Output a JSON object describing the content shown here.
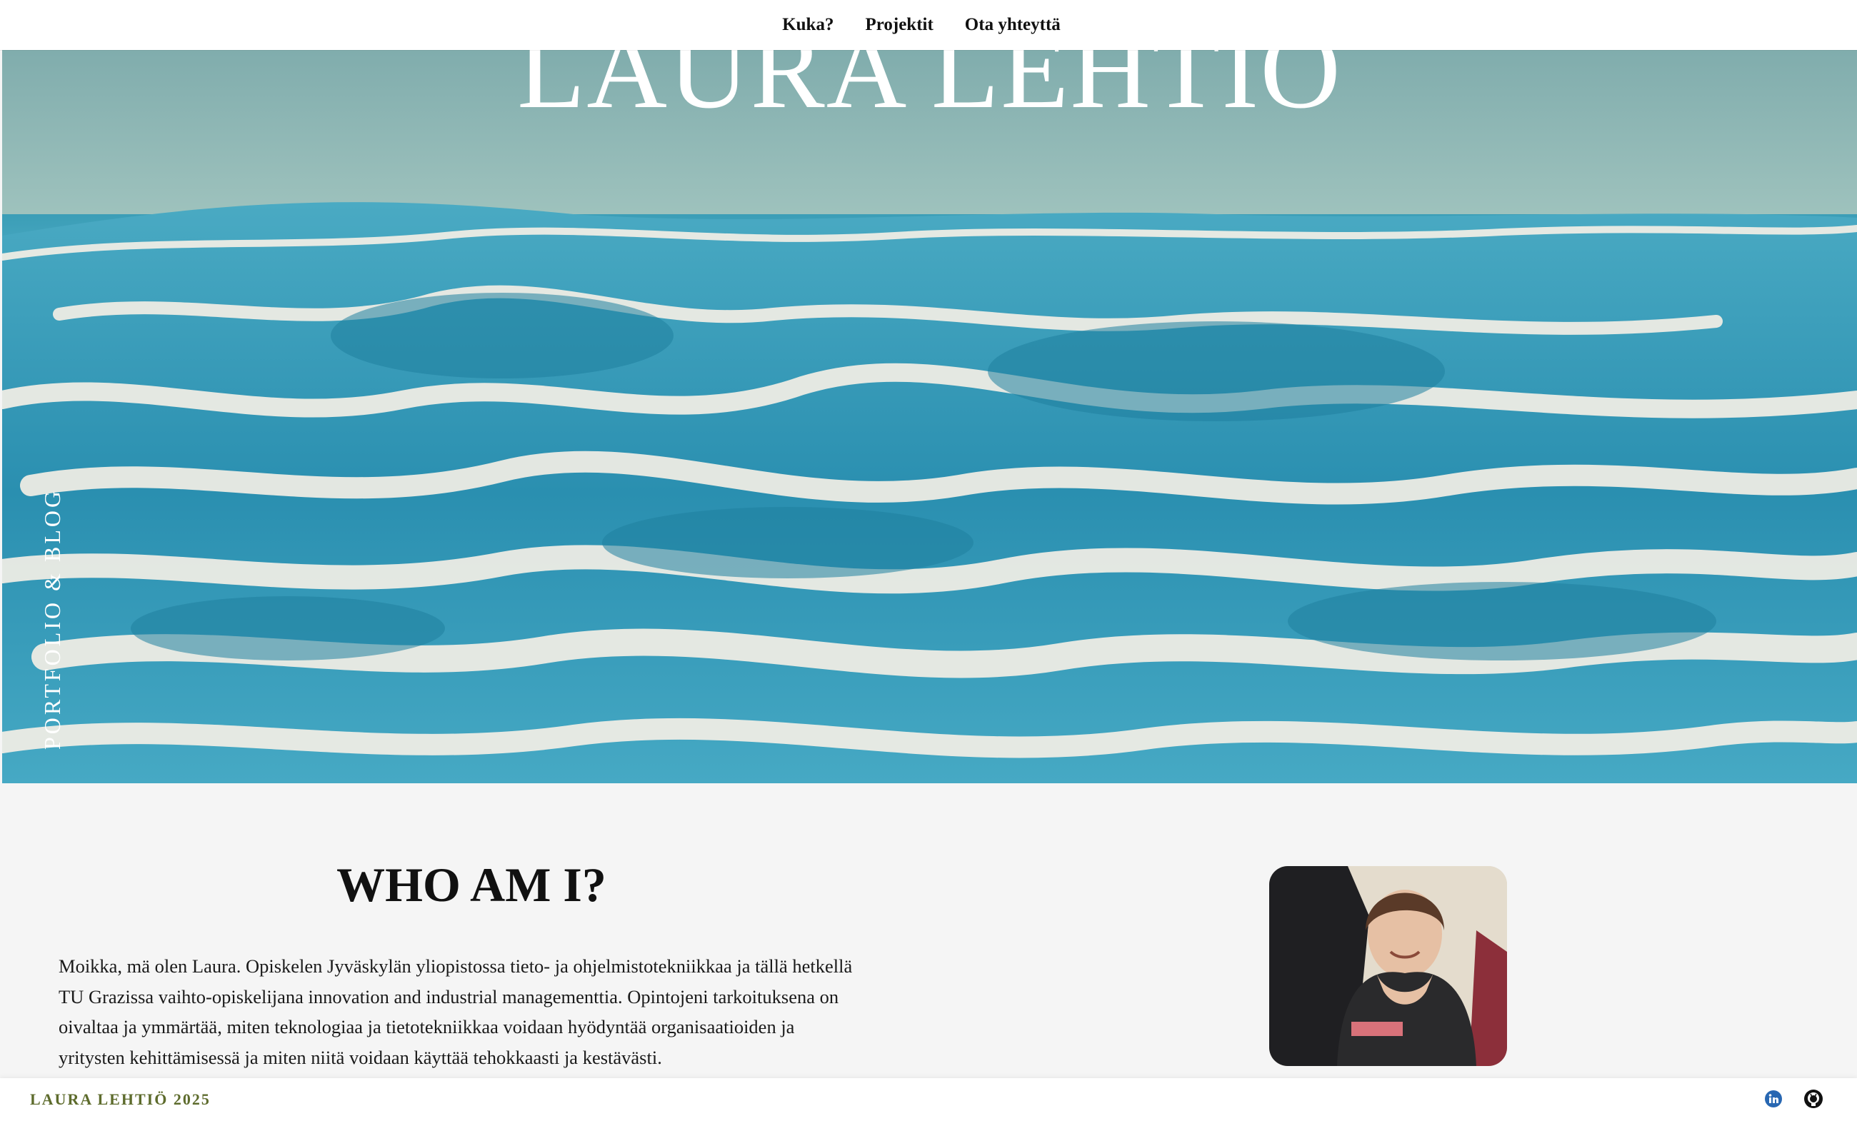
{
  "nav": {
    "items": [
      {
        "label": "Kuka?"
      },
      {
        "label": "Projektit"
      },
      {
        "label": "Ota yhteyttä"
      }
    ]
  },
  "hero": {
    "title": "LAURA LEHTIÖ",
    "side_label": "PORTFOLIO & BLOG"
  },
  "about": {
    "heading": "WHO AM I?",
    "paragraph": "Moikka, mä olen Laura. Opiskelen Jyväskylän yliopistossa tieto- ja ohjelmistotekniikkaa ja tällä hetkellä TU Grazissa vaihto-opiskelijana innovation and industrial managementtia. Opintojeni tarkoituksena on oivaltaa ja ymmärtää, miten teknologiaa ja tietotekniikkaa voidaan hyödyntää organisaatioiden ja yritysten kehittämisessä ja miten niitä voidaan käyttää tehokkaasti ja kestävästi."
  },
  "footer": {
    "brand": "LAURA LEHTIÖ 2025",
    "icons": [
      "linkedin-icon",
      "github-icon"
    ]
  },
  "colors": {
    "footer_brand": "#5d6b2c",
    "linkedin": "#2867b2",
    "sea": "#2e93b0"
  }
}
